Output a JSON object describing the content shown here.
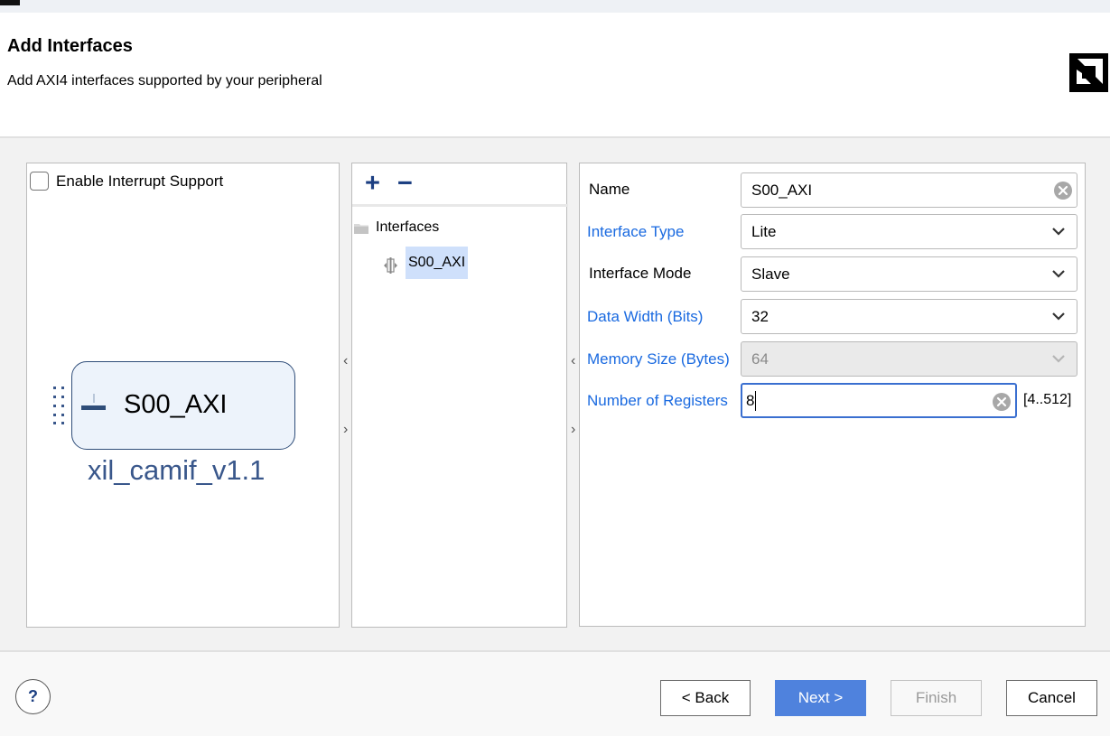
{
  "header": {
    "title": "Add Interfaces",
    "subtitle": "Add AXI4 interfaces supported by your peripheral",
    "logo_icon": "amd-logo-icon"
  },
  "left_panel": {
    "enable_interrupt_label": "Enable Interrupt Support",
    "enable_interrupt_checked": false,
    "block_interface_label": "S00_AXI",
    "block_name": "xil_camif_v1.1"
  },
  "middle_panel": {
    "add_label": "+",
    "remove_label": "−",
    "tree_root_label": "Interfaces",
    "tree_child_label": "S00_AXI"
  },
  "form": {
    "name_label": "Name",
    "name_value": "S00_AXI",
    "interface_type_label": "Interface Type",
    "interface_type_value": "Lite",
    "interface_mode_label": "Interface Mode",
    "interface_mode_value": "Slave",
    "data_width_label": "Data Width (Bits)",
    "data_width_value": "32",
    "memory_size_label": "Memory Size (Bytes)",
    "memory_size_value": "64",
    "num_registers_label": "Number of Registers",
    "num_registers_value": "8",
    "num_registers_range": "[4..512]"
  },
  "footer": {
    "help_label": "?",
    "back_label": "< Back",
    "next_label": "Next >",
    "finish_label": "Finish",
    "cancel_label": "Cancel"
  },
  "colors": {
    "accent": "#4f82dd",
    "link_blue": "#1a6ae0",
    "block_border": "#2f4d79",
    "block_name": "#39578b"
  }
}
